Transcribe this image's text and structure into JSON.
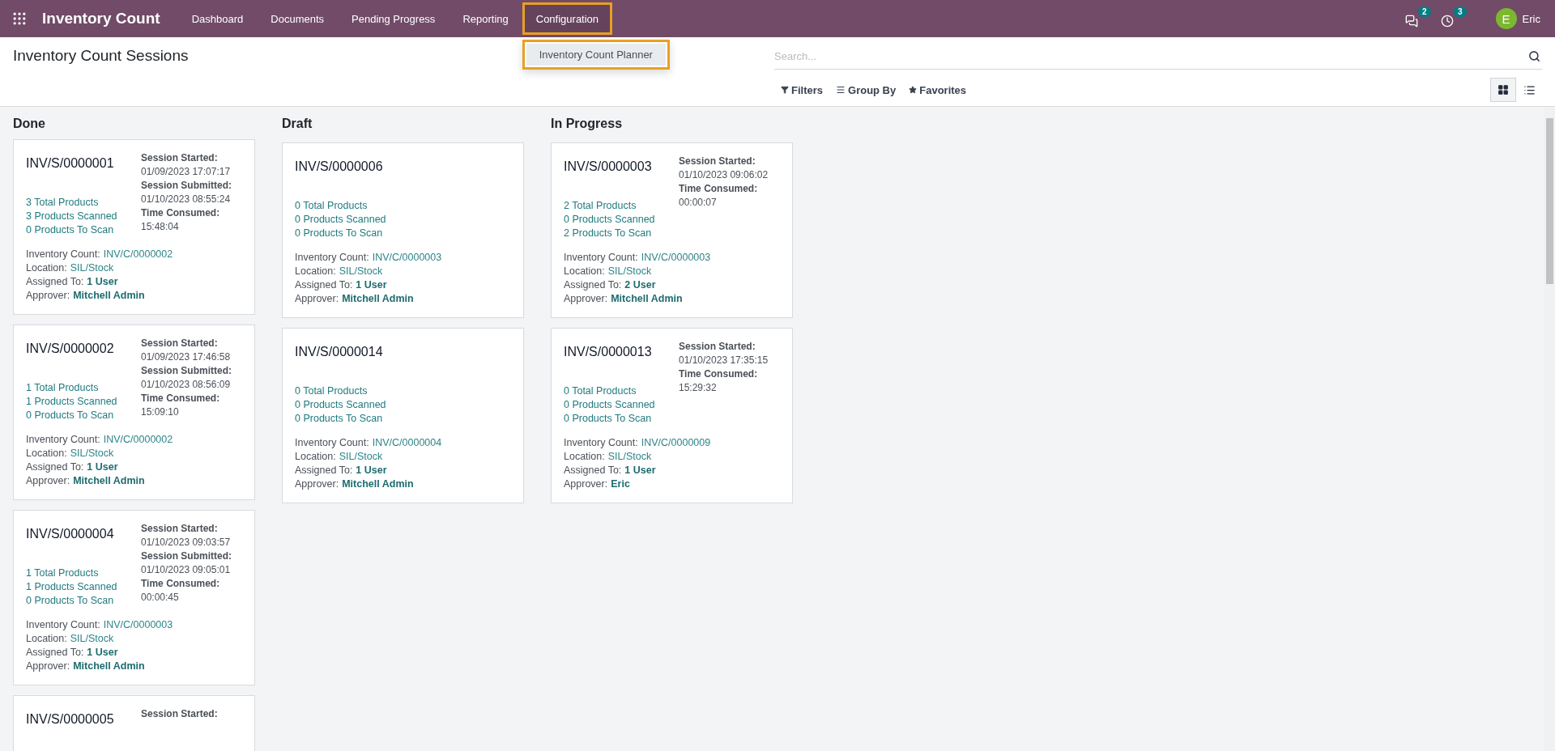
{
  "navbar": {
    "app_name": "Inventory Count",
    "menu": [
      {
        "label": "Dashboard",
        "selected": false
      },
      {
        "label": "Documents",
        "selected": false
      },
      {
        "label": "Pending Progress",
        "selected": false
      },
      {
        "label": "Reporting",
        "selected": false
      },
      {
        "label": "Configuration",
        "selected": true,
        "dropdown": [
          "Inventory Count Planner"
        ]
      }
    ],
    "systray": [
      {
        "kind": "messages",
        "badge": "2"
      },
      {
        "kind": "activity",
        "badge": "3"
      }
    ],
    "user": {
      "initial": "E",
      "name": "Eric"
    }
  },
  "control_panel": {
    "title": "Inventory Count Sessions",
    "search": {
      "placeholder": "Search..."
    },
    "filters": [
      {
        "kind": "filter",
        "label": "Filters"
      },
      {
        "kind": "group",
        "label": "Group By"
      },
      {
        "kind": "favorite",
        "label": "Favorites"
      }
    ],
    "views": [
      {
        "kind": "kanban",
        "selected": true
      },
      {
        "kind": "list",
        "selected": false
      }
    ]
  },
  "columns": [
    {
      "title": "Done",
      "cards": [
        {
          "title": "INV/S/0000001",
          "stats": [
            "3 Total Products",
            "3 Products Scanned",
            "0 Products To Scan"
          ],
          "times": [
            {
              "label": "Session Started:",
              "value": "01/09/2023 17:07:17"
            },
            {
              "label": "Session Submitted:",
              "value": "01/10/2023 08:55:24"
            },
            {
              "label": "Time Consumed:",
              "value": "15:48:04"
            }
          ],
          "details": [
            {
              "label": "Inventory Count:",
              "value": "INV/C/0000002",
              "kind": "link"
            },
            {
              "label": "Location:",
              "value": "SIL/Stock",
              "kind": "link"
            },
            {
              "label": "Assigned To:",
              "value": "1 User",
              "kind": "field"
            },
            {
              "label": "Approver:",
              "value": "Mitchell Admin",
              "kind": "field"
            }
          ]
        },
        {
          "title": "INV/S/0000002",
          "stats": [
            "1 Total Products",
            "1 Products Scanned",
            "0 Products To Scan"
          ],
          "times": [
            {
              "label": "Session Started:",
              "value": "01/09/2023 17:46:58"
            },
            {
              "label": "Session Submitted:",
              "value": "01/10/2023 08:56:09"
            },
            {
              "label": "Time Consumed:",
              "value": "15:09:10"
            }
          ],
          "details": [
            {
              "label": "Inventory Count:",
              "value": "INV/C/0000002",
              "kind": "link"
            },
            {
              "label": "Location:",
              "value": "SIL/Stock",
              "kind": "link"
            },
            {
              "label": "Assigned To:",
              "value": "1 User",
              "kind": "field"
            },
            {
              "label": "Approver:",
              "value": "Mitchell Admin",
              "kind": "field"
            }
          ]
        },
        {
          "title": "INV/S/0000004",
          "stats": [
            "1 Total Products",
            "1 Products Scanned",
            "0 Products To Scan"
          ],
          "times": [
            {
              "label": "Session Started:",
              "value": "01/10/2023 09:03:57"
            },
            {
              "label": "Session Submitted:",
              "value": "01/10/2023 09:05:01"
            },
            {
              "label": "Time Consumed:",
              "value": "00:00:45"
            }
          ],
          "details": [
            {
              "label": "Inventory Count:",
              "value": "INV/C/0000003",
              "kind": "link"
            },
            {
              "label": "Location:",
              "value": "SIL/Stock",
              "kind": "link"
            },
            {
              "label": "Assigned To:",
              "value": "1 User",
              "kind": "field"
            },
            {
              "label": "Approver:",
              "value": "Mitchell Admin",
              "kind": "field"
            }
          ]
        },
        {
          "title": "INV/S/0000005",
          "times": [
            {
              "label": "Session Started:"
            }
          ]
        }
      ]
    },
    {
      "title": "Draft",
      "cards": [
        {
          "title": "INV/S/0000006",
          "stats": [
            "0 Total Products",
            "0 Products Scanned",
            "0 Products To Scan"
          ],
          "details": [
            {
              "label": "Inventory Count:",
              "value": "INV/C/0000003",
              "kind": "link"
            },
            {
              "label": "Location:",
              "value": "SIL/Stock",
              "kind": "link"
            },
            {
              "label": "Assigned To:",
              "value": "1 User",
              "kind": "field"
            },
            {
              "label": "Approver:",
              "value": "Mitchell Admin",
              "kind": "field"
            }
          ]
        },
        {
          "title": "INV/S/0000014",
          "stats": [
            "0 Total Products",
            "0 Products Scanned",
            "0 Products To Scan"
          ],
          "details": [
            {
              "label": "Inventory Count:",
              "value": "INV/C/0000004",
              "kind": "link"
            },
            {
              "label": "Location:",
              "value": "SIL/Stock",
              "kind": "link"
            },
            {
              "label": "Assigned To:",
              "value": "1 User",
              "kind": "field"
            },
            {
              "label": "Approver:",
              "value": "Mitchell Admin",
              "kind": "field"
            }
          ]
        }
      ]
    },
    {
      "title": "In Progress",
      "cards": [
        {
          "title": "INV/S/0000003",
          "stats": [
            "2 Total Products",
            "0 Products Scanned",
            "2 Products To Scan"
          ],
          "times": [
            {
              "label": "Session Started:",
              "value": "01/10/2023 09:06:02"
            },
            {
              "label": "Time Consumed:",
              "value": "00:00:07"
            }
          ],
          "details": [
            {
              "label": "Inventory Count:",
              "value": "INV/C/0000003",
              "kind": "link"
            },
            {
              "label": "Location:",
              "value": "SIL/Stock",
              "kind": "link"
            },
            {
              "label": "Assigned To:",
              "value": "2 User",
              "kind": "field"
            },
            {
              "label": "Approver:",
              "value": "Mitchell Admin",
              "kind": "field"
            }
          ]
        },
        {
          "title": "INV/S/0000013",
          "stats": [
            "0 Total Products",
            "0 Products Scanned",
            "0 Products To Scan"
          ],
          "times": [
            {
              "label": "Session Started:",
              "value": "01/10/2023 17:35:15"
            },
            {
              "label": "Time Consumed:",
              "value": "15:29:32"
            }
          ],
          "details": [
            {
              "label": "Inventory Count:",
              "value": "INV/C/0000009",
              "kind": "link"
            },
            {
              "label": "Location:",
              "value": "SIL/Stock",
              "kind": "link"
            },
            {
              "label": "Assigned To:",
              "value": "1 User",
              "kind": "field"
            },
            {
              "label": "Approver:",
              "value": "Eric",
              "kind": "field"
            }
          ]
        }
      ]
    }
  ]
}
